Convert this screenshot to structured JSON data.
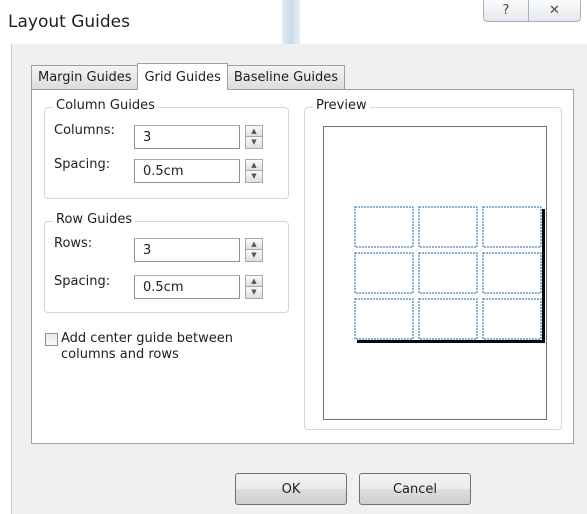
{
  "window": {
    "title": "Layout Guides",
    "help_glyph": "?",
    "close_glyph": "✕"
  },
  "tabs": [
    {
      "label": "Margin Guides"
    },
    {
      "label": "Grid Guides"
    },
    {
      "label": "Baseline Guides"
    }
  ],
  "column_guides": {
    "title": "Column Guides",
    "columns_label": "Columns:",
    "columns_value": "3",
    "spacing_label": "Spacing:",
    "spacing_value": "0.5cm"
  },
  "row_guides": {
    "title": "Row Guides",
    "rows_label": "Rows:",
    "rows_value": "3",
    "spacing_label": "Spacing:",
    "spacing_value": "0.5cm"
  },
  "center_guide": {
    "label_line1": "Add center guide between",
    "label_line2": "columns and rows",
    "checked": false
  },
  "preview": {
    "title": "Preview",
    "grid_columns": 3,
    "grid_rows": 3,
    "grid_color": "#1a5fb4"
  },
  "buttons": {
    "ok": "OK",
    "cancel": "Cancel"
  }
}
